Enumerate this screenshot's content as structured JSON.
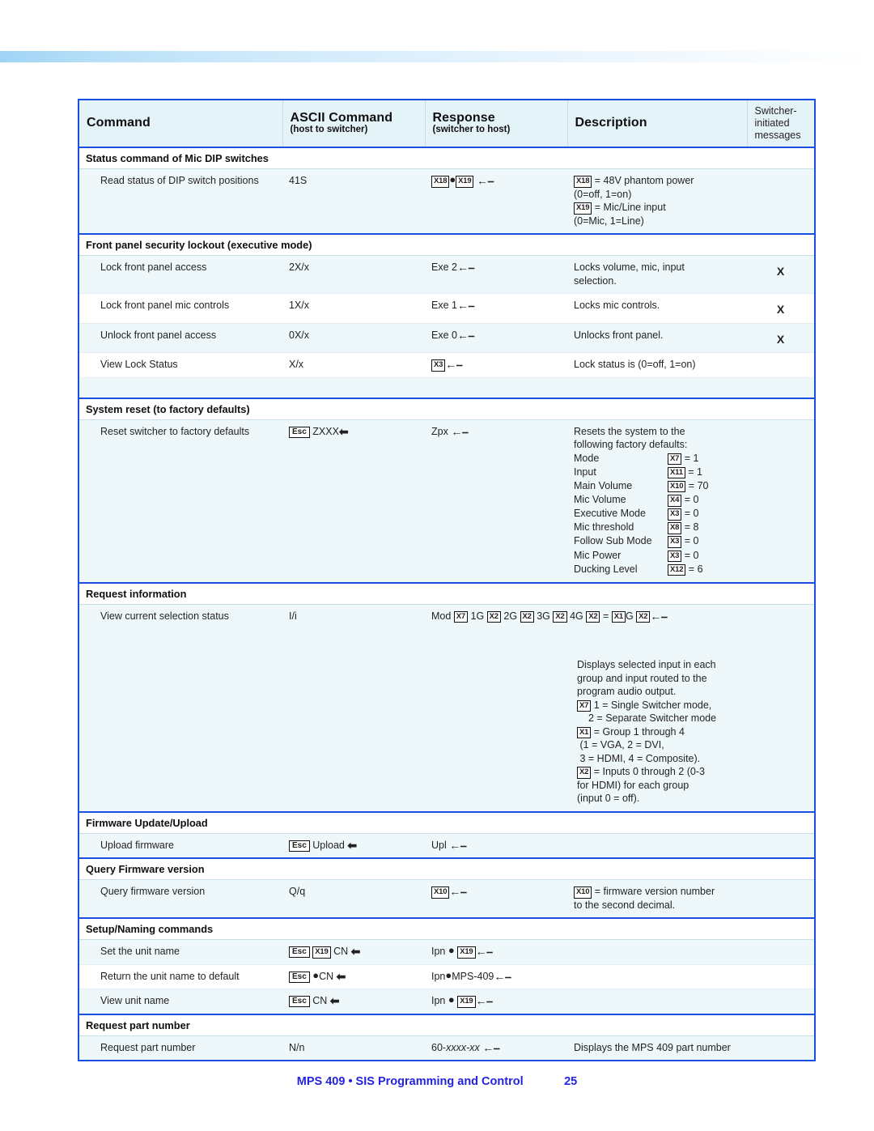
{
  "document": {
    "footer_title": "MPS 409 • SIS Programming and Control",
    "page_number": "25",
    "accent_color": "#1a4fe0",
    "footer_color": "#2323dd",
    "row_tint_color": "#eef8fa",
    "header_fill_color": "#e3f3f8"
  },
  "table": {
    "headers": {
      "command": "Command",
      "ascii_command": "ASCII Command",
      "ascii_command_sub": "(host to switcher)",
      "response": "Response",
      "response_sub": "(switcher to host)",
      "description": "Description",
      "switcher_initiated_l1": "Switcher-",
      "switcher_initiated_l2": "initiated",
      "switcher_initiated_l3": "messages"
    },
    "sections": [
      {
        "title": "Status command of Mic DIP switches",
        "rows": [
          {
            "command": "Read status of DIP switch positions",
            "ascii": "41S",
            "response_parts": [
              "X18",
              "●",
              "X19",
              "↵"
            ],
            "description_lines": [
              "X18 = 48V phantom power",
              "(0=off, 1=on)",
              "X19 = Mic/Line input",
              "(0=Mic, 1=Line)"
            ],
            "switcher_initiated": ""
          }
        ]
      },
      {
        "title": "Front panel security lockout (executive mode)",
        "rows": [
          {
            "command": "Lock front panel access",
            "ascii": "2X/x",
            "response": "Exe 2↵",
            "description_lines": [
              "Locks volume, mic, input",
              "selection."
            ],
            "switcher_initiated": "X"
          },
          {
            "command": "Lock front panel mic controls",
            "ascii": "1X/x",
            "response": "Exe 1↵",
            "description_lines": [
              "Locks mic controls."
            ],
            "switcher_initiated": "X"
          },
          {
            "command": "Unlock front panel access",
            "ascii": "0X/x",
            "response": "Exe 0↵",
            "description_lines": [
              "Unlocks front panel."
            ],
            "switcher_initiated": "X"
          },
          {
            "command": "View Lock Status",
            "ascii": "X/x",
            "response_parts": [
              "X3",
              "↵"
            ],
            "description_lines": [
              "Lock status is (0=off, 1=on)"
            ],
            "switcher_initiated": ""
          }
        ]
      },
      {
        "title": "System reset (to factory defaults)",
        "rows": [
          {
            "command": "Reset switcher to factory defaults",
            "ascii_esc": "Esc",
            "ascii": "ZXXX←",
            "response": "Zpx ↵",
            "description_lines": [
              "Resets the system to the",
              "following factory defaults:"
            ],
            "defaults": [
              {
                "name": "Mode",
                "var": "X7",
                "value": "= 1"
              },
              {
                "name": "Input",
                "var": "X11",
                "value": "= 1"
              },
              {
                "name": "Main Volume",
                "var": "X10",
                "value": "= 70"
              },
              {
                "name": "Mic Volume",
                "var": "X4",
                "value": "= 0"
              },
              {
                "name": "Executive Mode",
                "var": "X3",
                "value": "= 0"
              },
              {
                "name": "Mic threshold",
                "var": "X8",
                "value": "= 8"
              },
              {
                "name": "Follow Sub Mode",
                "var": "X3",
                "value": "= 0"
              },
              {
                "name": "Mic Power",
                "var": "X3",
                "value": "= 0"
              },
              {
                "name": "Ducking Level",
                "var": "X12",
                "value": "= 6"
              }
            ],
            "switcher_initiated": ""
          }
        ]
      },
      {
        "title": "Request information",
        "rows": [
          {
            "command": "View current selection status",
            "ascii": "I/i",
            "response_text": "Mod X7 1G X2 2G X2 3G X2 4G X2 = X1G X2↵",
            "description_lines": [
              "Displays selected input in each",
              "group and input routed to the",
              "program audio output.",
              "X7 1 = Single Switcher mode,",
              "2 = Separate Switcher mode",
              "X1 = Group 1 through 4",
              "(1 = VGA, 2 = DVI,",
              "3 = HDMI, 4 = Composite).",
              "X2 = Inputs 0 through 2 (0-3",
              "for HDMI) for each group",
              "(input 0 = off)."
            ],
            "switcher_initiated": ""
          }
        ]
      },
      {
        "title": "Firmware Update/Upload",
        "rows": [
          {
            "command": "Upload firmware",
            "ascii_esc": "Esc",
            "ascii": "Upload ←",
            "response": "Upl ↵",
            "description_lines": [],
            "switcher_initiated": ""
          }
        ]
      },
      {
        "title": "Query Firmware version",
        "rows": [
          {
            "command": "Query firmware version",
            "ascii": "Q/q",
            "response_parts": [
              "X10",
              "↵"
            ],
            "description_lines": [
              "X10 = firmware version number",
              "to the second decimal."
            ],
            "switcher_initiated": ""
          }
        ]
      },
      {
        "title": "Setup/Naming commands",
        "rows": [
          {
            "command": "Set the unit name",
            "ascii_esc": "Esc",
            "ascii": "X19 CN ←",
            "response": "Ipn ● X19↵",
            "description_lines": [],
            "switcher_initiated": ""
          },
          {
            "command": "Return the unit name to default",
            "ascii_esc": "Esc",
            "ascii": "●CN ←",
            "response": "Ipn●MPS-409↵",
            "description_lines": [],
            "switcher_initiated": ""
          },
          {
            "command": "View unit name",
            "ascii_esc": "Esc",
            "ascii": "CN ←",
            "response": "Ipn ● X19↵",
            "description_lines": [],
            "switcher_initiated": ""
          }
        ]
      },
      {
        "title": "Request part number",
        "rows": [
          {
            "command": "Request part number",
            "ascii": "N/n",
            "response_text": "60-xxxx-xx ↵",
            "description_lines": [
              "Displays the MPS 409 part number"
            ],
            "switcher_initiated": ""
          }
        ]
      }
    ]
  }
}
